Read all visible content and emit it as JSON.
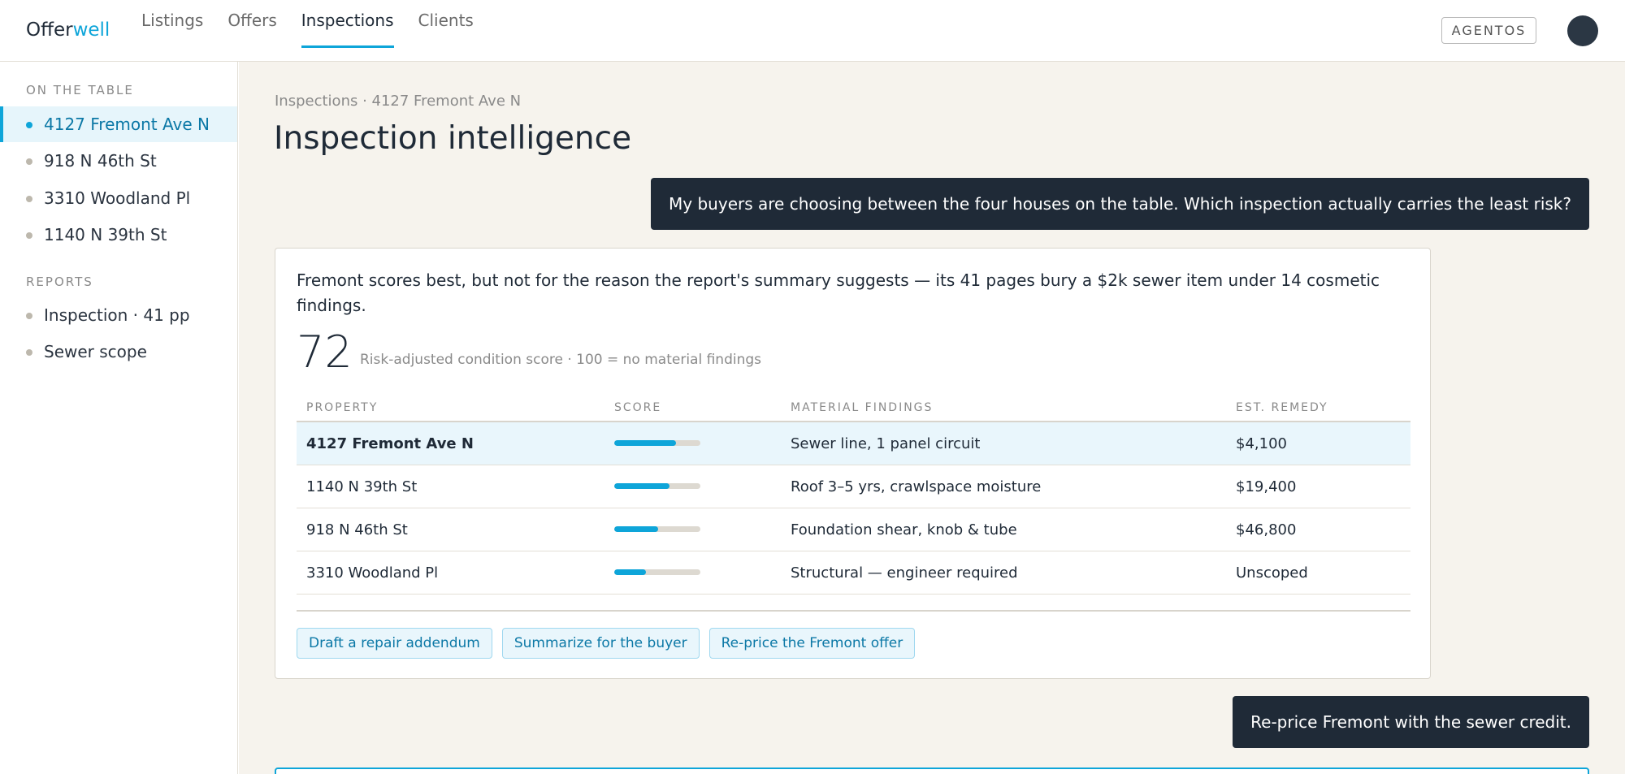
{
  "app": {
    "logo_main": "Offer",
    "logo_accent": "well"
  },
  "nav": [
    {
      "label": "Listings"
    },
    {
      "label": "Offers"
    },
    {
      "label": "Inspections"
    },
    {
      "label": "Clients"
    }
  ],
  "header": {
    "agentos_label": "AGENTOS"
  },
  "sidebar": {
    "table_heading": "ON THE TABLE",
    "table_items": [
      {
        "label": "4127 Fremont Ave N"
      },
      {
        "label": "918 N 46th St"
      },
      {
        "label": "3310 Woodland Pl"
      },
      {
        "label": "1140 N 39th St"
      }
    ],
    "reports_heading": "REPORTS",
    "report_items": [
      {
        "label": "Inspection · 41 pp"
      },
      {
        "label": "Sewer scope"
      }
    ]
  },
  "main": {
    "breadcrumb": "Inspections · 4127 Fremont Ave N",
    "title": "Inspection intelligence",
    "user_question": "My buyers are choosing between the four houses on the table. Which inspection actually carries the least risk?",
    "answer": {
      "text": "Fremont scores best, but not for the reason the report's summary suggests — its 41 pages bury a $2k sewer item under 14 cosmetic findings.",
      "score": "72",
      "score_caption": "Risk-adjusted condition score · 100 = no material findings",
      "columns": [
        "PROPERTY",
        "SCORE",
        "MATERIAL FINDINGS",
        "EST. REMEDY"
      ],
      "rows": [
        {
          "property": "4127 Fremont Ave N",
          "score_fraction": 0.72,
          "findings": "Sewer line, 1 panel circuit",
          "remedy": "$4,100"
        },
        {
          "property": "1140 N 39th St",
          "score_fraction": 0.64,
          "findings": "Roof 3–5 yrs, crawlspace moisture",
          "remedy": "$19,400"
        },
        {
          "property": "918 N 46th St",
          "score_fraction": 0.51,
          "findings": "Foundation shear, knob & tube",
          "remedy": "$46,800"
        },
        {
          "property": "3310 Woodland Pl",
          "score_fraction": 0.37,
          "findings": "Structural — engineer required",
          "remedy": "Unscoped"
        }
      ],
      "actions": [
        {
          "label": "Draft a repair addendum"
        },
        {
          "label": "Summarize for the buyer"
        },
        {
          "label": "Re-price the Fremont offer"
        }
      ]
    },
    "user_followup": "Re-price Fremont with the sewer credit."
  },
  "colors": {
    "accent": "#0ea5d9",
    "dark": "#1f2a37",
    "background": "#f6f3ed"
  }
}
